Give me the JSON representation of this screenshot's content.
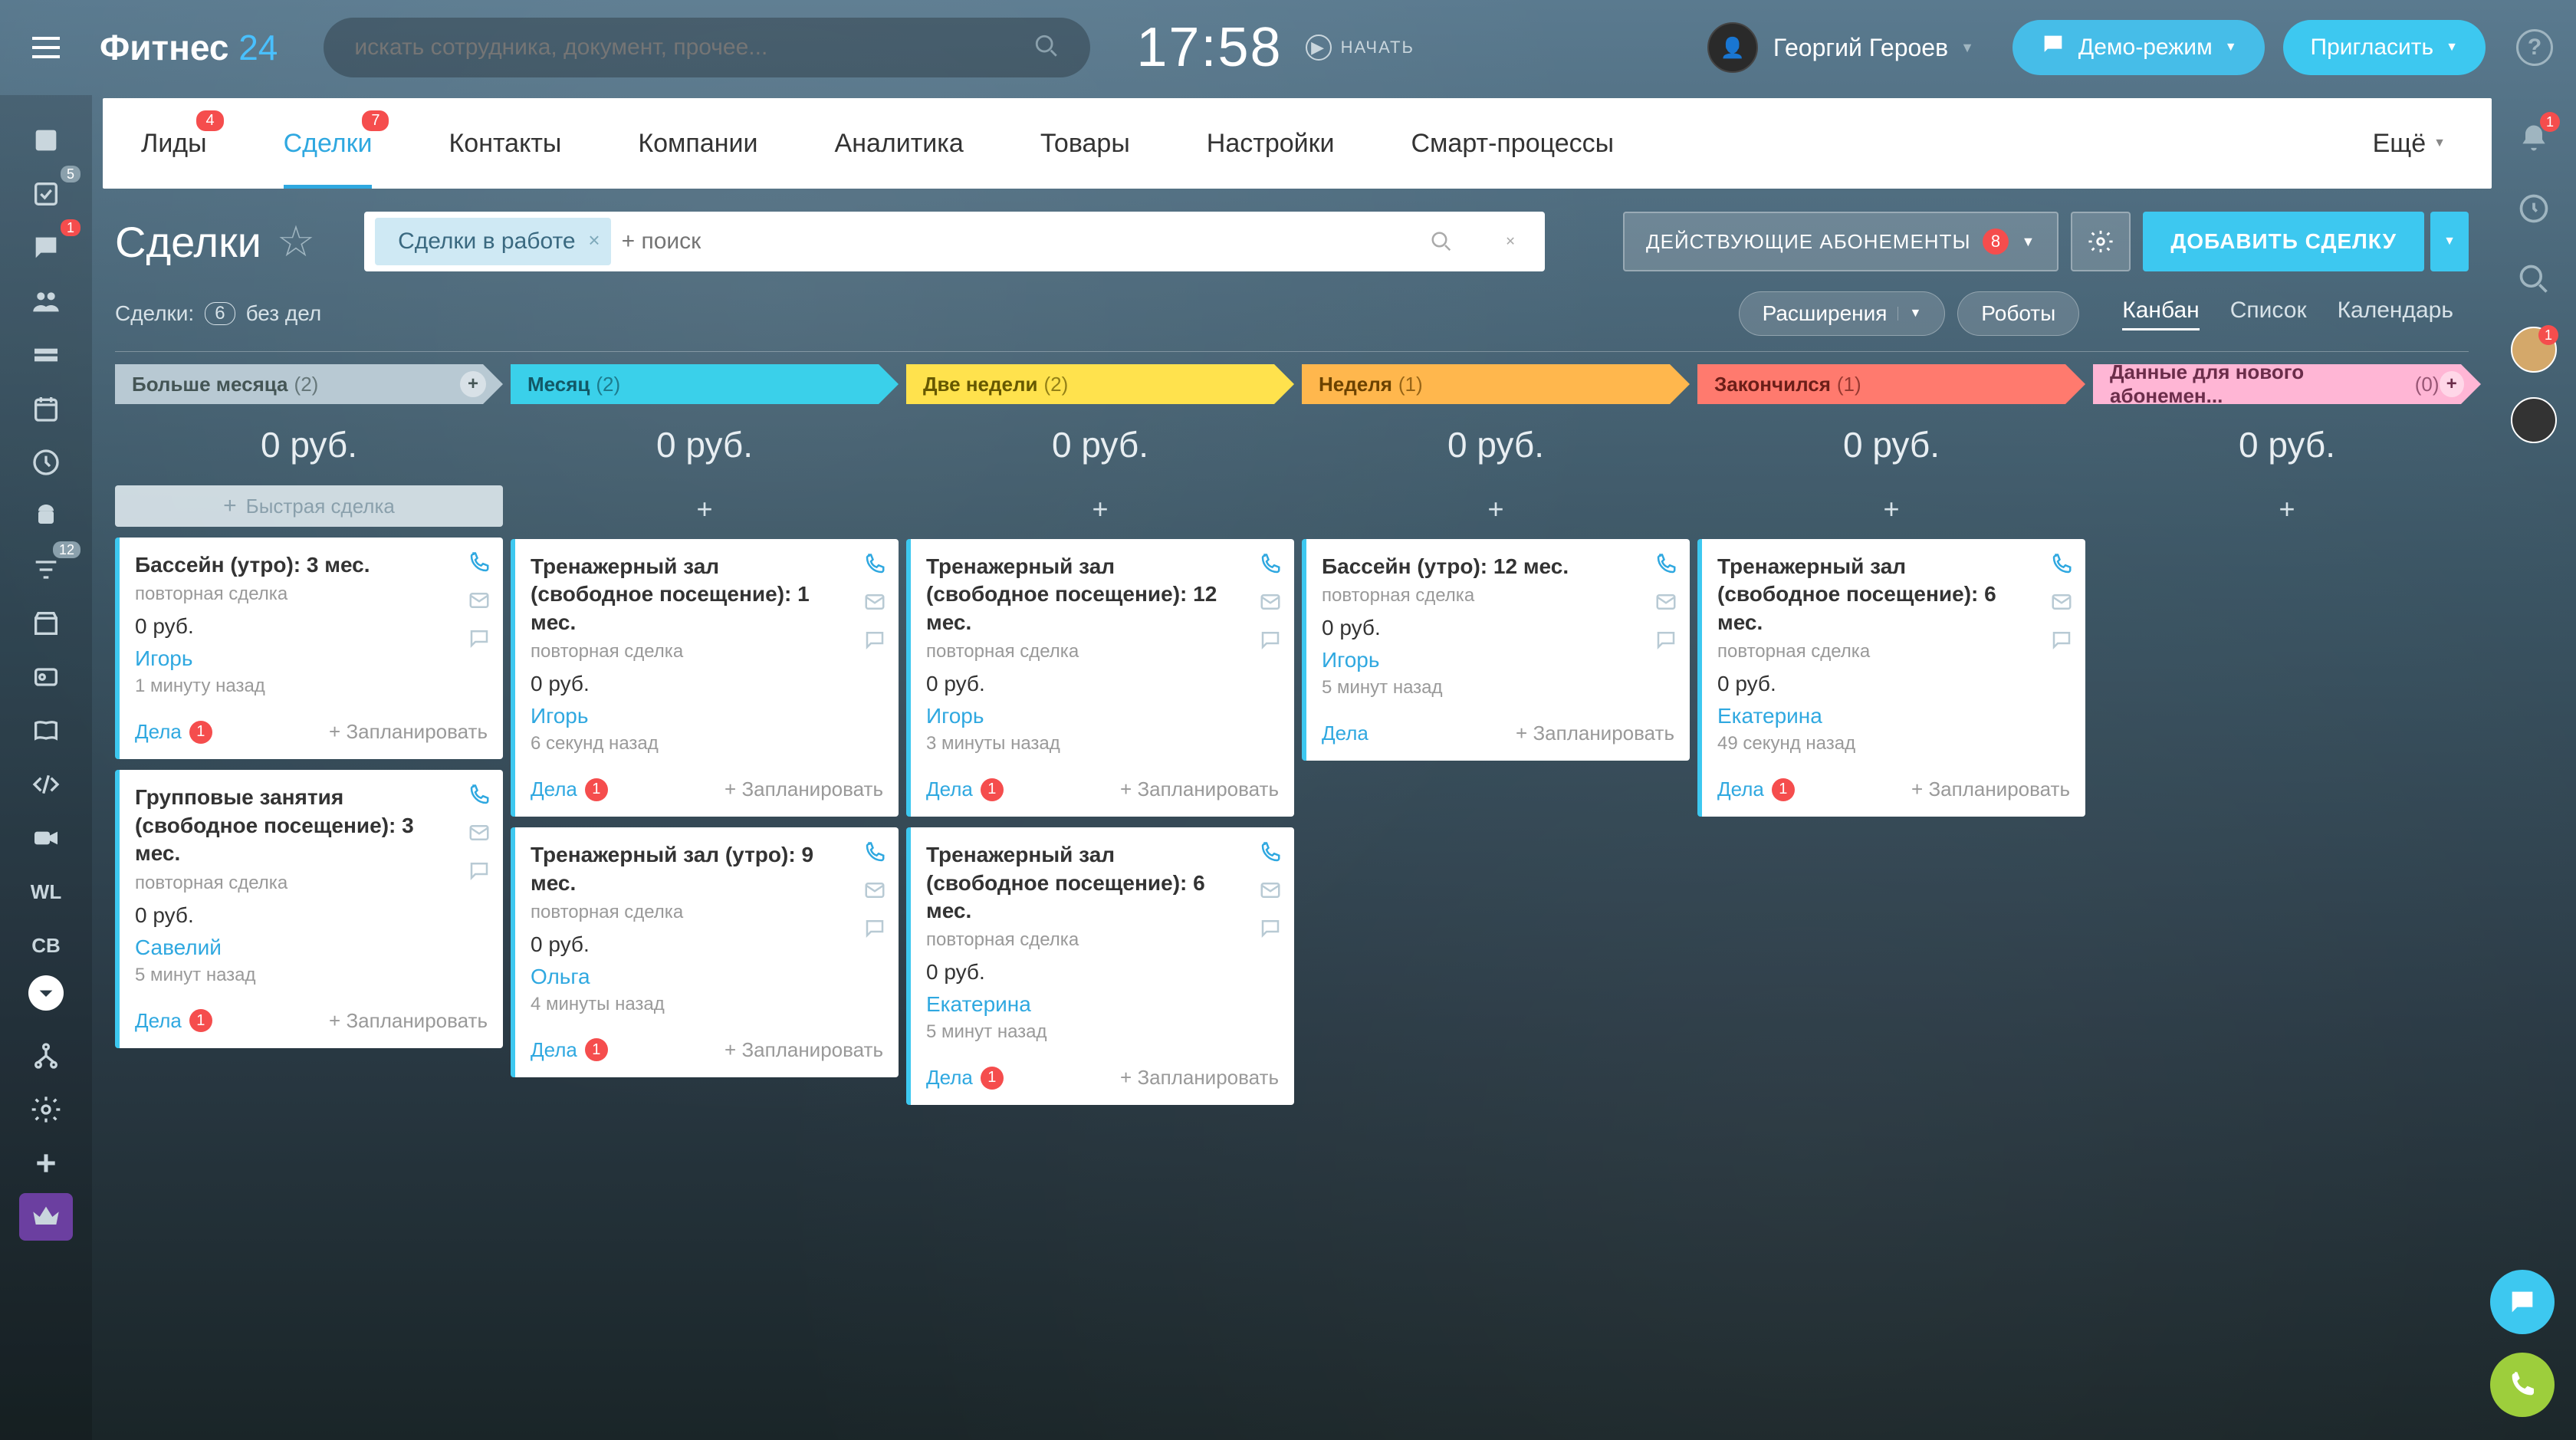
{
  "header": {
    "brand_a": "Фитнес ",
    "brand_b": "24",
    "search_placeholder": "искать сотрудника, документ, прочее...",
    "clock": "17:58",
    "start": "НАЧАТЬ",
    "user_name": "Георгий Героев",
    "demo": "Демо-режим",
    "invite": "Пригласить"
  },
  "leftdock": {
    "badges": {
      "tasks": "5",
      "chat": "1",
      "filter": "12"
    }
  },
  "rightdock": {
    "bell": "1",
    "av1": "1"
  },
  "nav": {
    "items": [
      {
        "label": "Лиды",
        "badge": "4"
      },
      {
        "label": "Сделки",
        "badge": "7",
        "active": true
      },
      {
        "label": "Контакты"
      },
      {
        "label": "Компании"
      },
      {
        "label": "Аналитика"
      },
      {
        "label": "Товары"
      },
      {
        "label": "Настройки"
      },
      {
        "label": "Смарт-процессы"
      }
    ],
    "more": "Ещё"
  },
  "subbar": {
    "title": "Сделки",
    "chip": "Сделки в работе",
    "search_placeholder": "+ поиск",
    "segment_label": "ДЕЙСТВУЮЩИЕ АБОНЕМЕНТЫ",
    "segment_badge": "8",
    "add_label": "ДОБАВИТЬ СДЕЛКУ"
  },
  "stats": {
    "label": "Сделки:",
    "count": "6",
    "no_deals": "без дел",
    "ext": "Расширения",
    "robots": "Роботы",
    "views": [
      "Канбан",
      "Список",
      "Календарь"
    ],
    "view_active": 0
  },
  "kanban": {
    "quick": "Быстрая сделка",
    "plan": "+ Запланировать",
    "dela": "Дела",
    "columns": [
      {
        "title": "Больше месяца",
        "count": "(2)",
        "sum": "0 руб.",
        "class": "col1",
        "cards": [
          {
            "title": "Бассейн (утро): 3 мес.",
            "sub": "повторная сделка",
            "price": "0 руб.",
            "link": "Игорь",
            "time": "1 минуту назад",
            "dela": "1"
          },
          {
            "title": "Групповые занятия (свободное посещение): 3 мес.",
            "sub": "повторная сделка",
            "price": "0 руб.",
            "link": "Савелий",
            "time": "5 минут назад",
            "dela": "1"
          }
        ]
      },
      {
        "title": "Месяц",
        "count": "(2)",
        "sum": "0 руб.",
        "class": "col2",
        "cards": [
          {
            "title": "Тренажерный зал (свободное посещение): 1 мес.",
            "sub": "повторная сделка",
            "price": "0 руб.",
            "link": "Игорь",
            "time": "6 секунд назад",
            "dela": "1"
          },
          {
            "title": "Тренажерный зал (утро): 9 мес.",
            "sub": "повторная сделка",
            "price": "0 руб.",
            "link": "Ольга",
            "time": "4 минуты назад",
            "dela": "1"
          }
        ]
      },
      {
        "title": "Две недели",
        "count": "(2)",
        "sum": "0 руб.",
        "class": "col3",
        "cards": [
          {
            "title": "Тренажерный зал (свободное посещение): 12 мес.",
            "sub": "повторная сделка",
            "price": "0 руб.",
            "link": "Игорь",
            "time": "3 минуты назад",
            "dela": "1"
          },
          {
            "title": "Тренажерный зал (свободное посещение): 6 мес.",
            "sub": "повторная сделка",
            "price": "0 руб.",
            "link": "Екатерина",
            "time": "5 минут назад",
            "dela": "1"
          }
        ]
      },
      {
        "title": "Неделя",
        "count": "(1)",
        "sum": "0 руб.",
        "class": "col4",
        "cards": [
          {
            "title": "Бассейн (утро): 12 мес.",
            "sub": "повторная сделка",
            "price": "0 руб.",
            "link": "Игорь",
            "time": "5 минут назад",
            "dela": ""
          }
        ]
      },
      {
        "title": "Закончился",
        "count": "(1)",
        "sum": "0 руб.",
        "class": "col5",
        "cards": [
          {
            "title": "Тренажерный зал (свободное посещение): 6 мес.",
            "sub": "повторная сделка",
            "price": "0 руб.",
            "link": "Екатерина",
            "time": "49 секунд назад",
            "dela": "1"
          }
        ]
      },
      {
        "title": "Данные для нового абонемен...",
        "count": "(0)",
        "sum": "0 руб.",
        "class": "col6",
        "cards": []
      }
    ]
  }
}
